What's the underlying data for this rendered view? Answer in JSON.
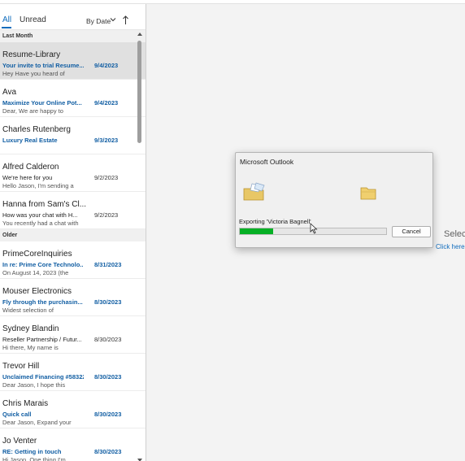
{
  "filter": {
    "tab_all": "All",
    "tab_unread": "Unread",
    "sort_label": "By Date"
  },
  "groups": [
    {
      "label": "Last Month",
      "messages": [
        {
          "sender": "Resume-Library",
          "subject": "Your invite to trial Resume...",
          "date": "9/4/2023",
          "preview": "Hey   Have you heard of",
          "unread": true,
          "selected": true
        },
        {
          "sender": "Ava",
          "subject": "Maximize Your Online Pot...",
          "date": "9/4/2023",
          "preview": "Dear,  We are happy to",
          "unread": true,
          "selected": false
        },
        {
          "sender": "Charles Rutenberg",
          "subject": "Luxury Real Estate",
          "date": "9/3/2023",
          "preview": "",
          "unread": true,
          "selected": false
        },
        {
          "sender": "Alfred Calderon",
          "subject": "We're here for you",
          "date": "9/2/2023",
          "preview": "Hello Jason,   I'm sending a",
          "unread": false,
          "selected": false
        },
        {
          "sender": "Hanna from Sam's Cl...",
          "subject": "How was your chat with H...",
          "date": "9/2/2023",
          "preview": "You recently had a chat with",
          "unread": false,
          "selected": false
        }
      ]
    },
    {
      "label": "Older",
      "messages": [
        {
          "sender": "PrimeCoreInquiries",
          "subject": "In re: Prime Core Technolo...",
          "date": "8/31/2023",
          "preview": "On August 14, 2023 (the",
          "unread": true,
          "selected": false
        },
        {
          "sender": "Mouser Electronics",
          "subject": "Fly through the purchasin...",
          "date": "8/30/2023",
          "preview": "Widest selection of",
          "unread": true,
          "selected": false
        },
        {
          "sender": "Sydney Blandin",
          "subject": "Reseller Partnership / Futur...",
          "date": "8/30/2023",
          "preview": "Hi there,       My name is",
          "unread": false,
          "selected": false
        },
        {
          "sender": "Trevor Hill",
          "subject": "Unclaimed Financing #58322",
          "date": "8/30/2023",
          "preview": "Dear Jason,  I hope this",
          "unread": true,
          "selected": false
        },
        {
          "sender": "Chris Marais",
          "subject": "Quick call",
          "date": "8/30/2023",
          "preview": "Dear Jason,  Expand your",
          "unread": true,
          "selected": false
        },
        {
          "sender": "Jo Venter",
          "subject": "RE: Getting in touch",
          "date": "8/30/2023",
          "preview": "Hi Jason,  One thing I'm",
          "unread": true,
          "selected": false
        }
      ]
    }
  ],
  "reading_pane": {
    "select_text": "Selec",
    "click_here": "Click here t"
  },
  "dialog": {
    "title": "Microsoft Outlook",
    "status": "Exporting 'Victoria Bagnell'",
    "progress": 0.23,
    "cancel_label": "Cancel"
  },
  "colors": {
    "accent": "#0f6cbd",
    "unread": "#115ea3",
    "progress_fill": "#06b025"
  }
}
